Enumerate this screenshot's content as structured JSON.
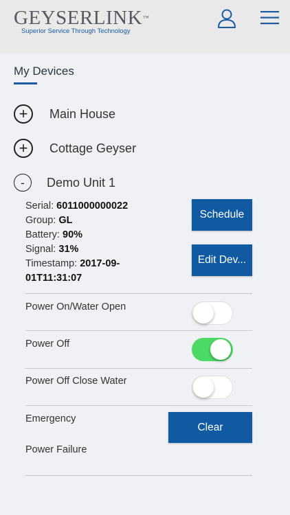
{
  "header": {
    "logo_main": "GEYSERLINK",
    "logo_tm": "™",
    "logo_tagline": "Superior Service Through Technology"
  },
  "section": {
    "title": "My Devices"
  },
  "devices": [
    {
      "name": "Main House",
      "toggle_symbol": "+"
    },
    {
      "name": "Cottage Geyser",
      "toggle_symbol": "+"
    },
    {
      "name": "Demo Unit 1",
      "toggle_symbol": "-"
    }
  ],
  "details": {
    "serial_label": "Serial:",
    "serial": "6011000000022",
    "group_label": "Group:",
    "group": "GL",
    "battery_label": "Battery:",
    "battery": "90%",
    "signal_label": "Signal:",
    "signal": "31%",
    "timestamp_label": "Timestamp:",
    "timestamp_part1": "2017-09-",
    "timestamp_part2": "01T11:31:07",
    "schedule_button": "Schedule",
    "edit_button": "Edit Dev..."
  },
  "controls": {
    "power_on_water_open": {
      "label": "Power On/Water Open",
      "state": "off"
    },
    "power_off": {
      "label": "Power Off",
      "state": "on"
    },
    "power_off_close_water": {
      "label": "Power Off Close Water",
      "state": "off"
    }
  },
  "emergency": {
    "label_line1": "Emergency",
    "label_line2": "Power Failure",
    "clear_button": "Clear"
  },
  "colors": {
    "accent": "#0f5aa0",
    "toggle_on": "#4cd964",
    "background": "#f0f1f4",
    "header": "#e9e9e9"
  },
  "icons": {
    "user": "user-outline-icon",
    "menu": "hamburger-menu-icon",
    "expand": "plus-circle-icon",
    "collapse": "minus-circle-icon"
  }
}
